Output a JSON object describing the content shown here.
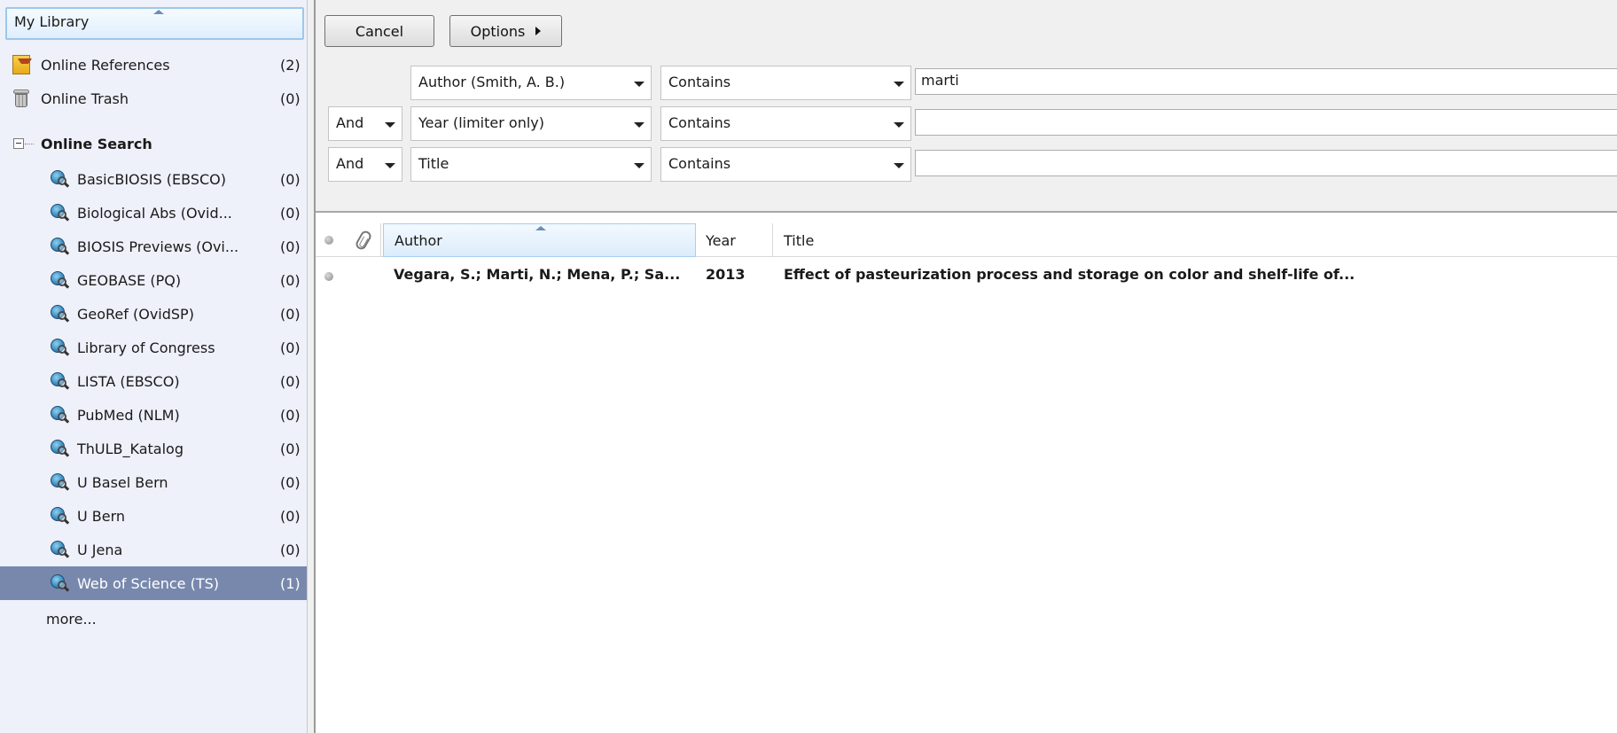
{
  "sidebar": {
    "header": "My Library",
    "groups": [
      {
        "label": "Online References",
        "count": "(2)",
        "icon": "folder-icon"
      },
      {
        "label": "Online Trash",
        "count": "(0)",
        "icon": "trash-icon"
      }
    ],
    "online_search": {
      "label": "Online Search",
      "expander": "minus",
      "items": [
        {
          "label": "BasicBIOSIS (EBSCO)",
          "count": "(0)"
        },
        {
          "label": "Biological Abs (Ovid...",
          "count": "(0)"
        },
        {
          "label": "BIOSIS Previews (Ovi...",
          "count": "(0)"
        },
        {
          "label": "GEOBASE (PQ)",
          "count": "(0)"
        },
        {
          "label": "GeoRef (OvidSP)",
          "count": "(0)"
        },
        {
          "label": "Library of Congress",
          "count": "(0)"
        },
        {
          "label": "LISTA (EBSCO)",
          "count": "(0)"
        },
        {
          "label": "PubMed (NLM)",
          "count": "(0)"
        },
        {
          "label": "ThULB_Katalog",
          "count": "(0)"
        },
        {
          "label": "U Basel Bern",
          "count": "(0)"
        },
        {
          "label": "U Bern",
          "count": "(0)"
        },
        {
          "label": "U Jena",
          "count": "(0)"
        },
        {
          "label": "Web of Science (TS)",
          "count": "(1)",
          "selected": true
        }
      ],
      "more": "more..."
    }
  },
  "search": {
    "cancel_label": "Cancel",
    "options_label": "Options",
    "rows": [
      {
        "bool": "",
        "field": "Author (Smith, A. B.)",
        "operator": "Contains",
        "value": "marti"
      },
      {
        "bool": "And",
        "field": "Year (limiter only)",
        "operator": "Contains",
        "value": ""
      },
      {
        "bool": "And",
        "field": "Title",
        "operator": "Contains",
        "value": ""
      }
    ]
  },
  "results": {
    "columns": {
      "author": "Author",
      "year": "Year",
      "title": "Title"
    },
    "sorted_by": "author",
    "rows": [
      {
        "author": "Vegara, S.; Marti, N.; Mena, P.; Sa...",
        "year": "2013",
        "title": "Effect of pasteurization process and storage on color and shelf-life of..."
      }
    ]
  },
  "colors": {
    "sidebar_bg": "#eef0fa",
    "selected_bg": "#7888ad",
    "header_highlight": "#dcecfb"
  }
}
